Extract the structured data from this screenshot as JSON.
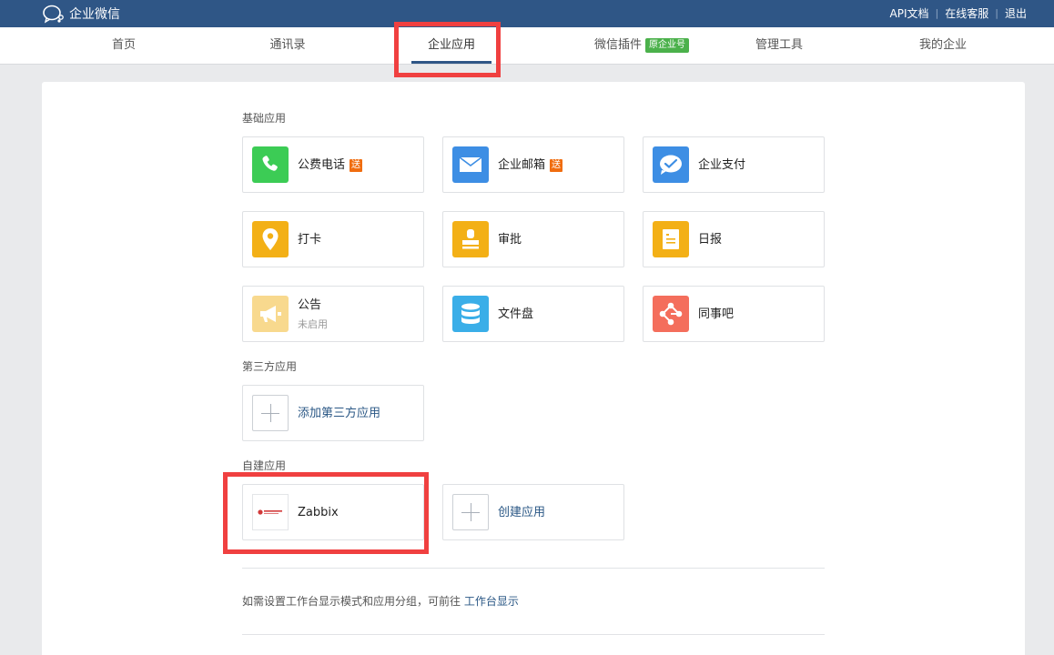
{
  "brand": {
    "name": "企业微信"
  },
  "toplinks": {
    "api_docs": "API文档",
    "support": "在线客服",
    "logout": "退出",
    "separator": "|"
  },
  "nav": [
    {
      "label": "首页"
    },
    {
      "label": "通讯录"
    },
    {
      "label": "企业应用"
    },
    {
      "label": "微信插件",
      "badge": "原企业号"
    },
    {
      "label": "管理工具"
    },
    {
      "label": "我的企业"
    }
  ],
  "sections": {
    "basic": "基础应用",
    "third_party": "第三方应用",
    "self_built": "自建应用"
  },
  "basic_apps": [
    {
      "label": "公费电话",
      "badge": "送",
      "icon": "phone-icon",
      "color": "#3ccc55"
    },
    {
      "label": "企业邮箱",
      "badge": "送",
      "icon": "mail-icon",
      "color": "#3d8ee4"
    },
    {
      "label": "企业支付",
      "icon": "payment-icon",
      "color": "#3d8ee4"
    },
    {
      "label": "打卡",
      "icon": "location-pin-icon",
      "color": "#f3b016"
    },
    {
      "label": "审批",
      "icon": "stamp-icon",
      "color": "#f3b016"
    },
    {
      "label": "日报",
      "icon": "report-icon",
      "color": "#f3b016"
    },
    {
      "label": "公告",
      "sub": "未启用",
      "icon": "megaphone-icon",
      "color": "#f8d98e"
    },
    {
      "label": "文件盘",
      "icon": "database-icon",
      "color": "#3aaee8"
    },
    {
      "label": "同事吧",
      "icon": "network-icon",
      "color": "#f46e5c"
    }
  ],
  "third_party": {
    "add_label": "添加第三方应用"
  },
  "self_built": {
    "zabbix_label": "Zabbix",
    "create_label": "创建应用"
  },
  "hint": {
    "text": "如需设置工作台显示模式和应用分组，可前往",
    "link": "工作台显示"
  }
}
